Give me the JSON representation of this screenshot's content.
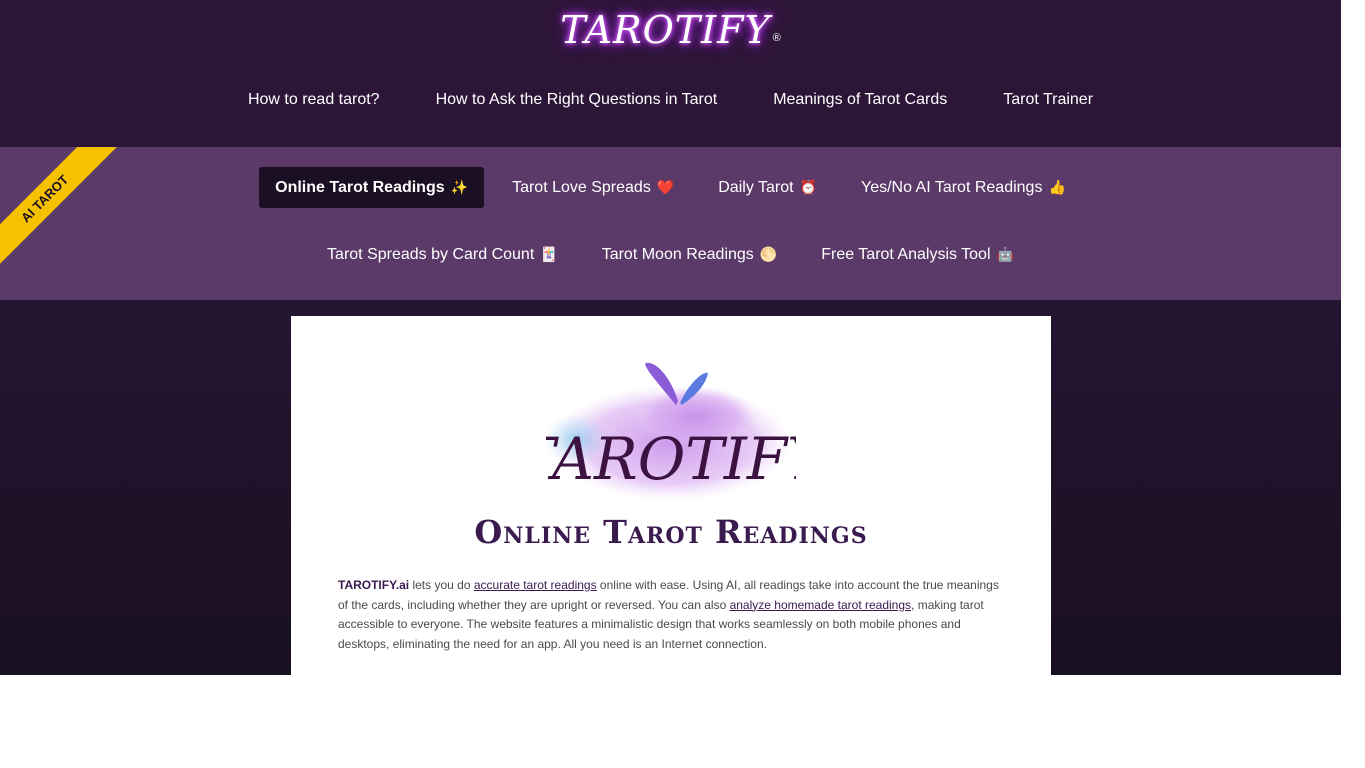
{
  "header": {
    "logo": "TAROTIFY",
    "logo_mark": "®",
    "nav": [
      "How to read tarot?",
      "How to Ask the Right Questions in Tarot",
      "Meanings of Tarot Cards",
      "Tarot Trainer"
    ]
  },
  "ribbon": "AI TAROT",
  "subnav": {
    "row1": [
      {
        "label": "Online Tarot Readings",
        "emoji": "✨"
      },
      {
        "label": "Tarot Love Spreads",
        "emoji": "❤️"
      },
      {
        "label": "Daily Tarot",
        "emoji": "⏰"
      },
      {
        "label": "Yes/No AI Tarot Readings",
        "emoji": "👍"
      }
    ],
    "row2": [
      {
        "label": "Tarot Spreads by Card Count",
        "emoji": "🃏"
      },
      {
        "label": "Tarot Moon Readings",
        "emoji": "🌕"
      },
      {
        "label": "Free Tarot Analysis Tool",
        "emoji": "🤖"
      }
    ]
  },
  "main": {
    "hero_logo_text": "TAROTIFY",
    "title": "Online Tarot Readings",
    "intro": {
      "brand": "TAROTIFY.ai",
      "part1": " lets you do ",
      "link1": "accurate tarot readings",
      "part2": " online with ease. Using AI, all readings take into account the true meanings of the cards, including whether they are upright or reversed. You can also ",
      "link2": "analyze homemade tarot readings",
      "part3": ", making tarot accessible to everyone. The website features a minimalistic design that works seamlessly on both mobile phones and desktops, eliminating the need for an app. All you need is an Internet connection."
    }
  },
  "colors": {
    "header_bg": "#2d1538",
    "subnav_bg": "#5b3a69",
    "active_pill": "#1b0f24",
    "ribbon": "#f6c200",
    "accent": "#3a1a4f"
  }
}
